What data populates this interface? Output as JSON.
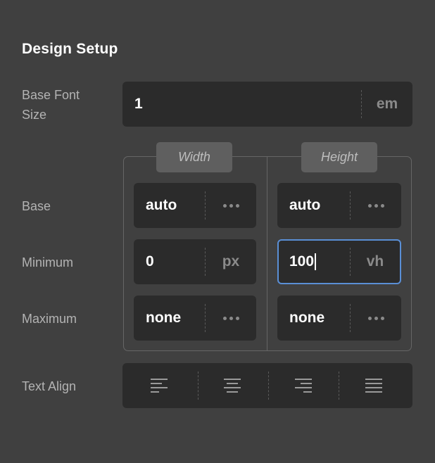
{
  "title": "Design Setup",
  "base_font_size": {
    "label_line1": "Base Font",
    "label_line2": "Size",
    "value": "1",
    "unit": "em"
  },
  "columns": {
    "width_label": "Width",
    "height_label": "Height"
  },
  "rows": {
    "base": {
      "label": "Base",
      "width_value": "auto",
      "height_value": "auto"
    },
    "minimum": {
      "label": "Minimum",
      "width_value": "0",
      "width_unit": "px",
      "height_value": "100",
      "height_unit": "vh"
    },
    "maximum": {
      "label": "Maximum",
      "width_value": "none",
      "height_value": "none"
    }
  },
  "text_align": {
    "label": "Text Align",
    "options": [
      "left",
      "center",
      "right",
      "justify"
    ]
  },
  "icons": {
    "more": "more-dots-icon",
    "align_left": "align-left-icon",
    "align_center": "align-center-icon",
    "align_right": "align-right-icon",
    "align_justify": "align-justify-icon"
  },
  "colors": {
    "background": "#404040",
    "field": "#2b2b2b",
    "focus_border": "#5a8fd6",
    "label": "#b3b3b3"
  }
}
